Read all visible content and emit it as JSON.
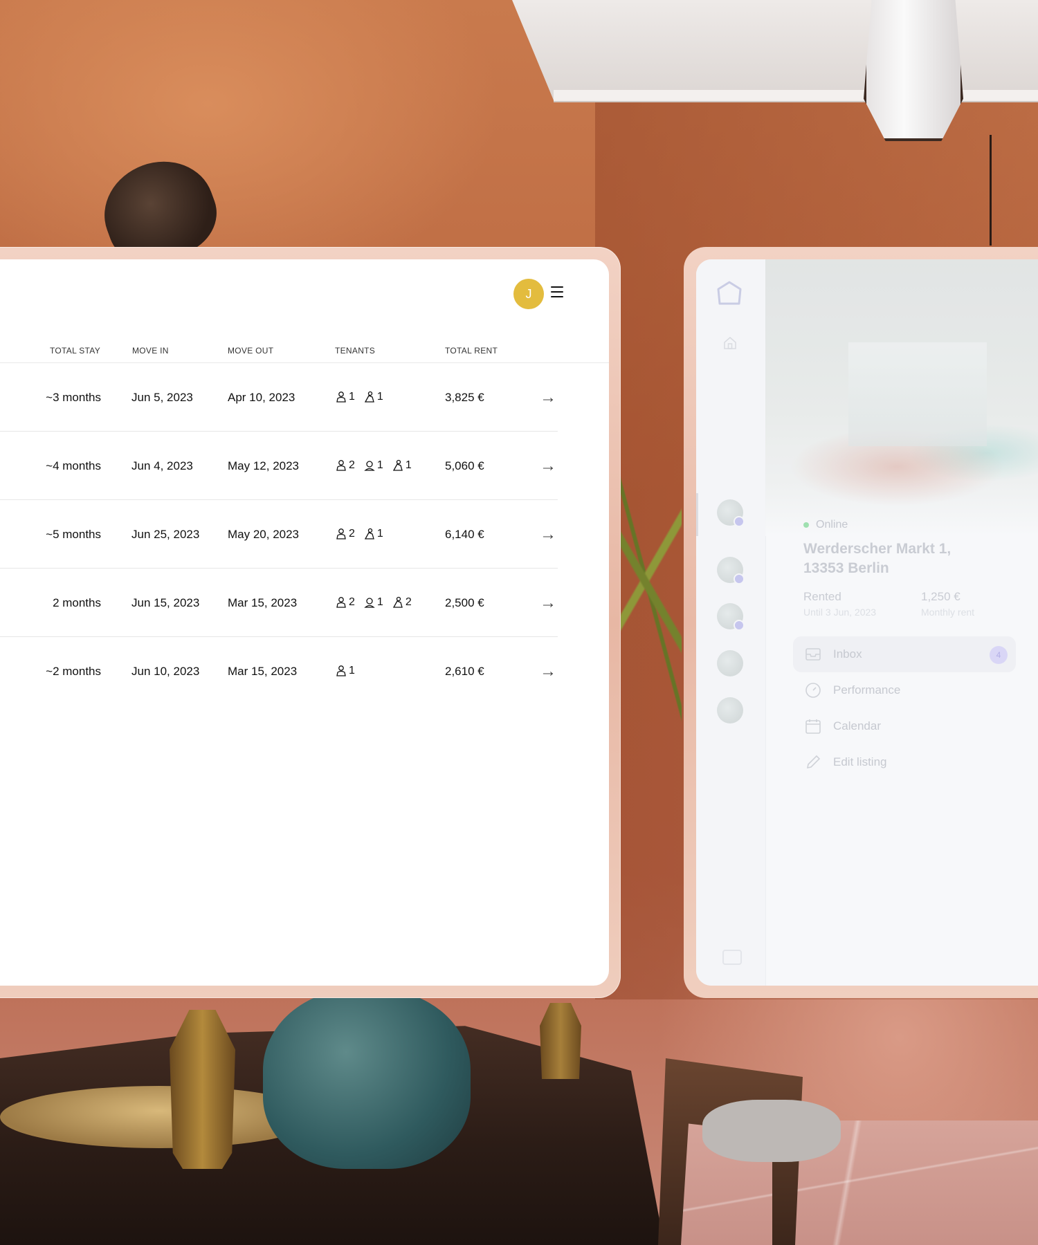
{
  "user": {
    "avatar_initial": "J",
    "avatar_color": "#e3bc3e"
  },
  "table": {
    "headers": [
      "TOTAL STAY",
      "MOVE IN",
      "MOVE OUT",
      "TENANTS",
      "TOTAL RENT"
    ],
    "rows": [
      {
        "total_stay": "~3 months",
        "move_in": "Jun 5, 2023",
        "move_out": "Apr 10, 2023",
        "tenants": [
          {
            "icon": "adult-icon",
            "count": "1"
          },
          {
            "icon": "child-icon",
            "count": "1"
          }
        ],
        "total_rent": "3,825 €"
      },
      {
        "total_stay": "~4 months",
        "move_in": "Jun 4, 2023",
        "move_out": "May 12, 2023",
        "tenants": [
          {
            "icon": "adult-icon",
            "count": "2"
          },
          {
            "icon": "baby-icon",
            "count": "1"
          },
          {
            "icon": "child-icon",
            "count": "1"
          }
        ],
        "total_rent": "5,060 €"
      },
      {
        "total_stay": "~5 months",
        "move_in": "Jun 25, 2023",
        "move_out": "May 20, 2023",
        "tenants": [
          {
            "icon": "adult-icon",
            "count": "2"
          },
          {
            "icon": "child-icon",
            "count": "1"
          }
        ],
        "total_rent": "6,140 €"
      },
      {
        "total_stay": "2 months",
        "move_in": "Jun 15, 2023",
        "move_out": "Mar 15, 2023",
        "tenants": [
          {
            "icon": "adult-icon",
            "count": "2"
          },
          {
            "icon": "baby-icon",
            "count": "1"
          },
          {
            "icon": "child-icon",
            "count": "2"
          }
        ],
        "total_rent": "2,500 €"
      },
      {
        "total_stay": "~2 months",
        "move_in": "Jun 10, 2023",
        "move_out": "Mar 15, 2023",
        "tenants": [
          {
            "icon": "adult-icon",
            "count": "1"
          }
        ],
        "total_rent": "2,610 €"
      }
    ]
  },
  "listing": {
    "status": "Online",
    "status_color": "#9fe0b0",
    "address": "Werderscher Markt 1, 13353 Berlin",
    "state_label": "Rented",
    "state_sub": "Until 3 Jun, 2023",
    "rent_label": "1,250 €",
    "rent_sub": "Monthly rent"
  },
  "nav": {
    "items": [
      {
        "label": "Inbox",
        "icon": "inbox-icon",
        "badge": "4"
      },
      {
        "label": "Performance",
        "icon": "performance-icon"
      },
      {
        "label": "Calendar",
        "icon": "calendar-icon"
      },
      {
        "label": "Edit listing",
        "icon": "pencil-icon"
      }
    ]
  },
  "colors": {
    "accent": "#a9a8e8",
    "frame": "#e8b9a6"
  }
}
